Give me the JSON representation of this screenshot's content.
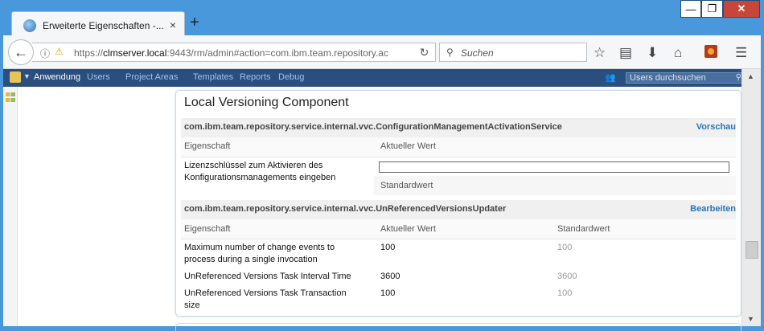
{
  "browser": {
    "tab_title": "Erweiterte Eigenschaften -...",
    "tab_close": "×",
    "new_tab": "+",
    "url_prefix": "https://",
    "url_host": "clmserver.local",
    "url_rest": ":9443/rm/admin#action=com.ibm.team.repository.ac",
    "search_placeholder": "Suchen",
    "window_min": "—",
    "window_max": "❐",
    "window_close": "✕"
  },
  "appbar": {
    "menu": [
      "Anwendung",
      "Users",
      "Project Areas",
      "Templates",
      "Reports",
      "Debug"
    ],
    "user_search_placeholder": "Users durchsuchen"
  },
  "panel": {
    "title": "Local Versioning Component",
    "section1": {
      "name": "com.ibm.team.repository.service.internal.vvc.ConfigurationManagementActivationService",
      "action": "Vorschau",
      "col_property": "Eigenschaft",
      "col_current": "Aktueller Wert",
      "row_label": "Lizenzschlüssel zum Aktivieren des Konfigurationsmanagements eingeben",
      "row_value": "",
      "default_label": "Standardwert"
    },
    "section2": {
      "name": "com.ibm.team.repository.service.internal.vvc.UnReferencedVersionsUpdater",
      "action": "Bearbeiten",
      "col_property": "Eigenschaft",
      "col_current": "Aktueller Wert",
      "col_default": "Standardwert",
      "rows": [
        {
          "label": "Maximum number of change events to process during a single invocation",
          "current": "100",
          "default": "100"
        },
        {
          "label": "UnReferenced Versions Task Interval Time",
          "current": "3600",
          "default": "3600"
        },
        {
          "label": "UnReferenced Versions Task Transaction size",
          "current": "100",
          "default": "100"
        }
      ]
    }
  },
  "colors": {
    "window_frame": "#4a98dc",
    "app_header": "#2a4e7e",
    "link": "#2876b8"
  }
}
